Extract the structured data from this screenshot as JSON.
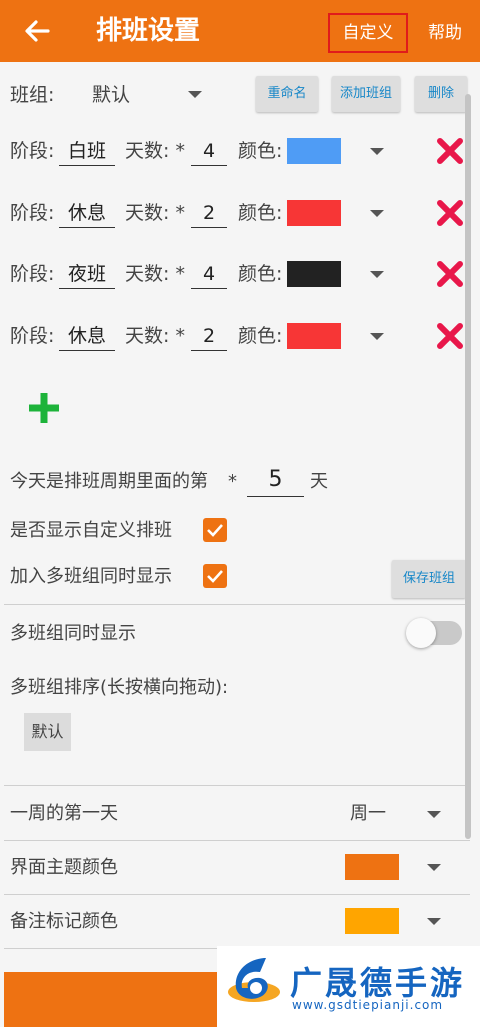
{
  "appbar": {
    "title": "排班设置",
    "custom_label": "自定义",
    "help_label": "帮助"
  },
  "group": {
    "label": "班组:",
    "value": "默认",
    "rename": "重命名",
    "add_group": "添加班组",
    "delete": "删除"
  },
  "stages": [
    {
      "stage_label": "阶段:",
      "name": "白班",
      "days_label": "天数: *",
      "days": "4",
      "color_label": "颜色:",
      "color": "#4f9cf5"
    },
    {
      "stage_label": "阶段:",
      "name": "休息",
      "days_label": "天数: *",
      "days": "2",
      "color_label": "颜色:",
      "color": "#f73636"
    },
    {
      "stage_label": "阶段:",
      "name": "夜班",
      "days_label": "天数: *",
      "days": "4",
      "color_label": "颜色:",
      "color": "#222222"
    },
    {
      "stage_label": "阶段:",
      "name": "休息",
      "days_label": "天数: *",
      "days": "2",
      "color_label": "颜色:",
      "color": "#f73636"
    }
  ],
  "cycle": {
    "prefix": "今天是排班周期里面的第",
    "star": "*",
    "value": "5",
    "suffix": "天"
  },
  "show_custom": {
    "label": "是否显示自定义排班",
    "checked": true
  },
  "join_multi": {
    "label": "加入多班组同时显示",
    "checked": true,
    "save_label": "保存班组"
  },
  "multi_display": {
    "label": "多班组同时显示",
    "enabled": false
  },
  "multi_sort": {
    "label": "多班组排序(长按横向拖动):",
    "chips": [
      "默认"
    ]
  },
  "first_day": {
    "label": "一周的第一天",
    "value": "周一"
  },
  "theme_color": {
    "label": "界面主题颜色",
    "color": "#ee7212"
  },
  "note_color": {
    "label": "备注标记颜色",
    "color": "#ffa500"
  },
  "watermark": {
    "name": "广晟德手游",
    "url": "www.gsdtiepianji.com"
  },
  "colors": {
    "accent": "#ee7212",
    "delete_red": "#e8174a",
    "add_green": "#1db33a"
  }
}
